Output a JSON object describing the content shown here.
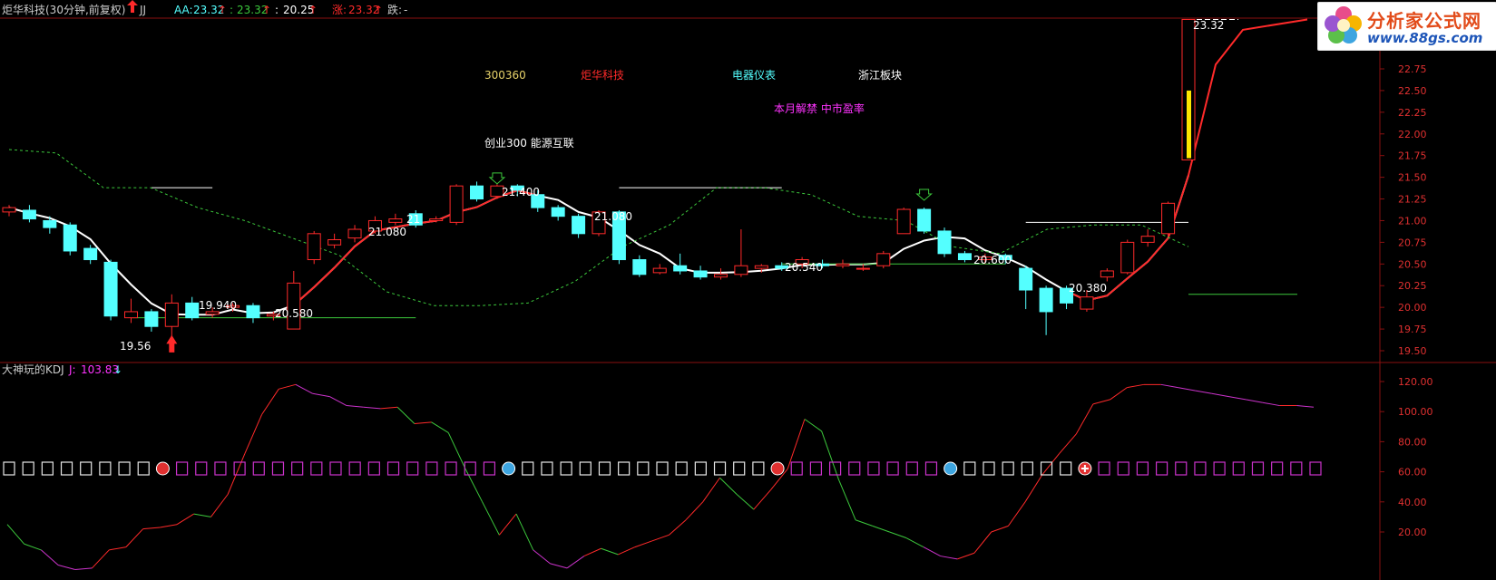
{
  "header": {
    "stock_title": "炬华科技(30分钟,前复权)",
    "indicator_name": "JJ",
    "aa_label": "AA:",
    "aa_value": "23.32",
    "val2": "23.32",
    "val3": "20.25",
    "zhang_label": "涨:",
    "zhang_value": "23.32",
    "die_label": "跌:",
    "die_value": "-"
  },
  "annotations": {
    "code": "300360",
    "name": "炬华科技",
    "industry": "电器仪表",
    "region": "浙江板块",
    "concepts": "创业300 能源互联",
    "events": "本月解禁 中市盈率"
  },
  "price_labels": [
    "19.56",
    "19.940",
    "20.580",
    "21.080",
    "21",
    "21.400",
    "21.080",
    "20.540",
    "20.600",
    "20.380",
    "23.32"
  ],
  "kdj_header": {
    "name": "大神玩的KDJ",
    "j_label": "J:",
    "j_value": "103.83"
  },
  "logo": {
    "name": "分析家公式网",
    "url": "www.88gs.com"
  },
  "colors": {
    "up": "#ff2a2a",
    "down": "#54ffff",
    "support": "#3cc83c",
    "resist": "#ffffff",
    "kdj_up": "#ff2a2a",
    "kdj_down": "#3cc83c",
    "kdj_mid": "#cc33cc",
    "yellow": "#ffe600"
  },
  "chart_data": [
    {
      "type": "candlestick",
      "title": "炬华科技(30分钟,前复权)",
      "ylim": [
        19.4,
        23.4
      ],
      "yticks": [
        "22.75",
        "22.50",
        "22.25",
        "22.00",
        "21.75",
        "21.50",
        "21.25",
        "21.00",
        "20.75",
        "20.50",
        "20.25",
        "20.00",
        "19.75",
        "19.50"
      ],
      "candles": [
        [
          21.1,
          21.15,
          21.18,
          21.05
        ],
        [
          21.12,
          21.02,
          21.18,
          20.98
        ],
        [
          21.0,
          20.92,
          21.05,
          20.85
        ],
        [
          20.95,
          20.65,
          20.98,
          20.6
        ],
        [
          20.68,
          20.55,
          20.72,
          20.5
        ],
        [
          20.52,
          19.9,
          20.55,
          19.85
        ],
        [
          19.88,
          19.95,
          20.1,
          19.82
        ],
        [
          19.95,
          19.78,
          19.98,
          19.72
        ],
        [
          19.78,
          20.05,
          20.15,
          19.6
        ],
        [
          20.05,
          19.88,
          20.12,
          19.85
        ],
        [
          19.92,
          19.95,
          20.0,
          19.88
        ],
        [
          20.0,
          20.02,
          20.05,
          19.95
        ],
        [
          20.02,
          19.88,
          20.05,
          19.82
        ],
        [
          19.9,
          19.92,
          19.95,
          19.85
        ],
        [
          19.75,
          20.28,
          20.42,
          19.75
        ],
        [
          20.55,
          20.85,
          20.88,
          20.5
        ],
        [
          20.72,
          20.78,
          20.85,
          20.68
        ],
        [
          20.8,
          20.9,
          20.95,
          20.75
        ],
        [
          20.88,
          21.0,
          21.05,
          20.85
        ],
        [
          20.98,
          21.02,
          21.08,
          20.95
        ],
        [
          21.08,
          20.95,
          21.12,
          20.92
        ],
        [
          21.0,
          21.02,
          21.05,
          20.98
        ],
        [
          20.98,
          21.4,
          21.42,
          20.95
        ],
        [
          21.4,
          21.25,
          21.45,
          21.22
        ],
        [
          21.28,
          21.4,
          21.42,
          21.25
        ],
        [
          21.4,
          21.35,
          21.42,
          21.28
        ],
        [
          21.3,
          21.15,
          21.35,
          21.1
        ],
        [
          21.15,
          21.05,
          21.18,
          21.0
        ],
        [
          21.05,
          20.85,
          21.08,
          20.8
        ],
        [
          20.85,
          21.1,
          21.12,
          20.82
        ],
        [
          21.1,
          20.55,
          21.12,
          20.5
        ],
        [
          20.55,
          20.38,
          20.6,
          20.35
        ],
        [
          20.4,
          20.45,
          20.5,
          20.38
        ],
        [
          20.48,
          20.42,
          20.62,
          20.38
        ],
        [
          20.42,
          20.35,
          20.48,
          20.32
        ],
        [
          20.35,
          20.38,
          20.45,
          20.32
        ],
        [
          20.38,
          20.48,
          20.9,
          20.35
        ],
        [
          20.45,
          20.48,
          20.5,
          20.4
        ],
        [
          20.48,
          20.45,
          20.52,
          20.42
        ],
        [
          20.5,
          20.55,
          20.58,
          20.45
        ],
        [
          20.5,
          20.48,
          20.55,
          20.45
        ],
        [
          20.48,
          20.5,
          20.55,
          20.45
        ],
        [
          20.45,
          20.45,
          20.5,
          20.42
        ],
        [
          20.48,
          20.62,
          20.65,
          20.45
        ],
        [
          20.85,
          21.13,
          21.15,
          20.85
        ],
        [
          21.13,
          20.88,
          21.15,
          20.85
        ],
        [
          20.88,
          20.62,
          20.92,
          20.58
        ],
        [
          20.62,
          20.55,
          20.65,
          20.52
        ],
        [
          20.55,
          20.58,
          20.62,
          20.5
        ],
        [
          20.6,
          20.55,
          20.62,
          20.5
        ],
        [
          20.45,
          20.2,
          20.48,
          19.98
        ],
        [
          20.22,
          19.95,
          20.25,
          19.68
        ],
        [
          20.22,
          20.05,
          20.25,
          19.98
        ],
        [
          19.98,
          20.12,
          20.2,
          19.95
        ],
        [
          20.35,
          20.42,
          20.45,
          20.3
        ],
        [
          20.4,
          20.75,
          20.78,
          20.38
        ],
        [
          20.75,
          20.82,
          20.9,
          20.7
        ],
        [
          20.85,
          21.2,
          21.22,
          20.82
        ],
        [
          21.7,
          23.32,
          23.32,
          21.7
        ]
      ],
      "lines": [
        {
          "name": "AA",
          "values": [
            23.32
          ]
        },
        {
          "name": "support",
          "values": [
            19.88,
            20.5,
            20.15
          ]
        },
        {
          "name": "resistance",
          "values": [
            21.38,
            21.38,
            20.98
          ]
        }
      ]
    },
    {
      "type": "line",
      "title": "大神玩的KDJ",
      "ylim": [
        0,
        125
      ],
      "yticks": [
        "120.00",
        "100.00",
        "80.00",
        "60.00",
        "40.00",
        "20.00"
      ],
      "series": [
        {
          "name": "J",
          "values": [
            25,
            12,
            8,
            -2,
            -5,
            -4,
            8,
            10,
            22,
            23,
            25,
            32,
            30,
            45,
            72,
            98,
            115,
            118,
            112,
            110,
            104,
            103,
            102,
            103,
            92,
            93,
            86,
            62,
            40,
            18,
            32,
            8,
            -1,
            -4,
            4,
            9,
            5,
            10,
            14,
            18,
            28,
            40,
            56,
            45,
            35,
            48,
            62,
            95,
            87,
            55,
            28,
            24,
            20,
            16,
            10,
            4,
            2,
            6,
            20,
            24,
            40,
            58,
            72,
            85,
            105,
            108,
            116,
            118,
            118,
            116,
            114,
            112,
            110,
            108,
            106,
            104,
            104,
            103
          ]
        }
      ]
    }
  ]
}
